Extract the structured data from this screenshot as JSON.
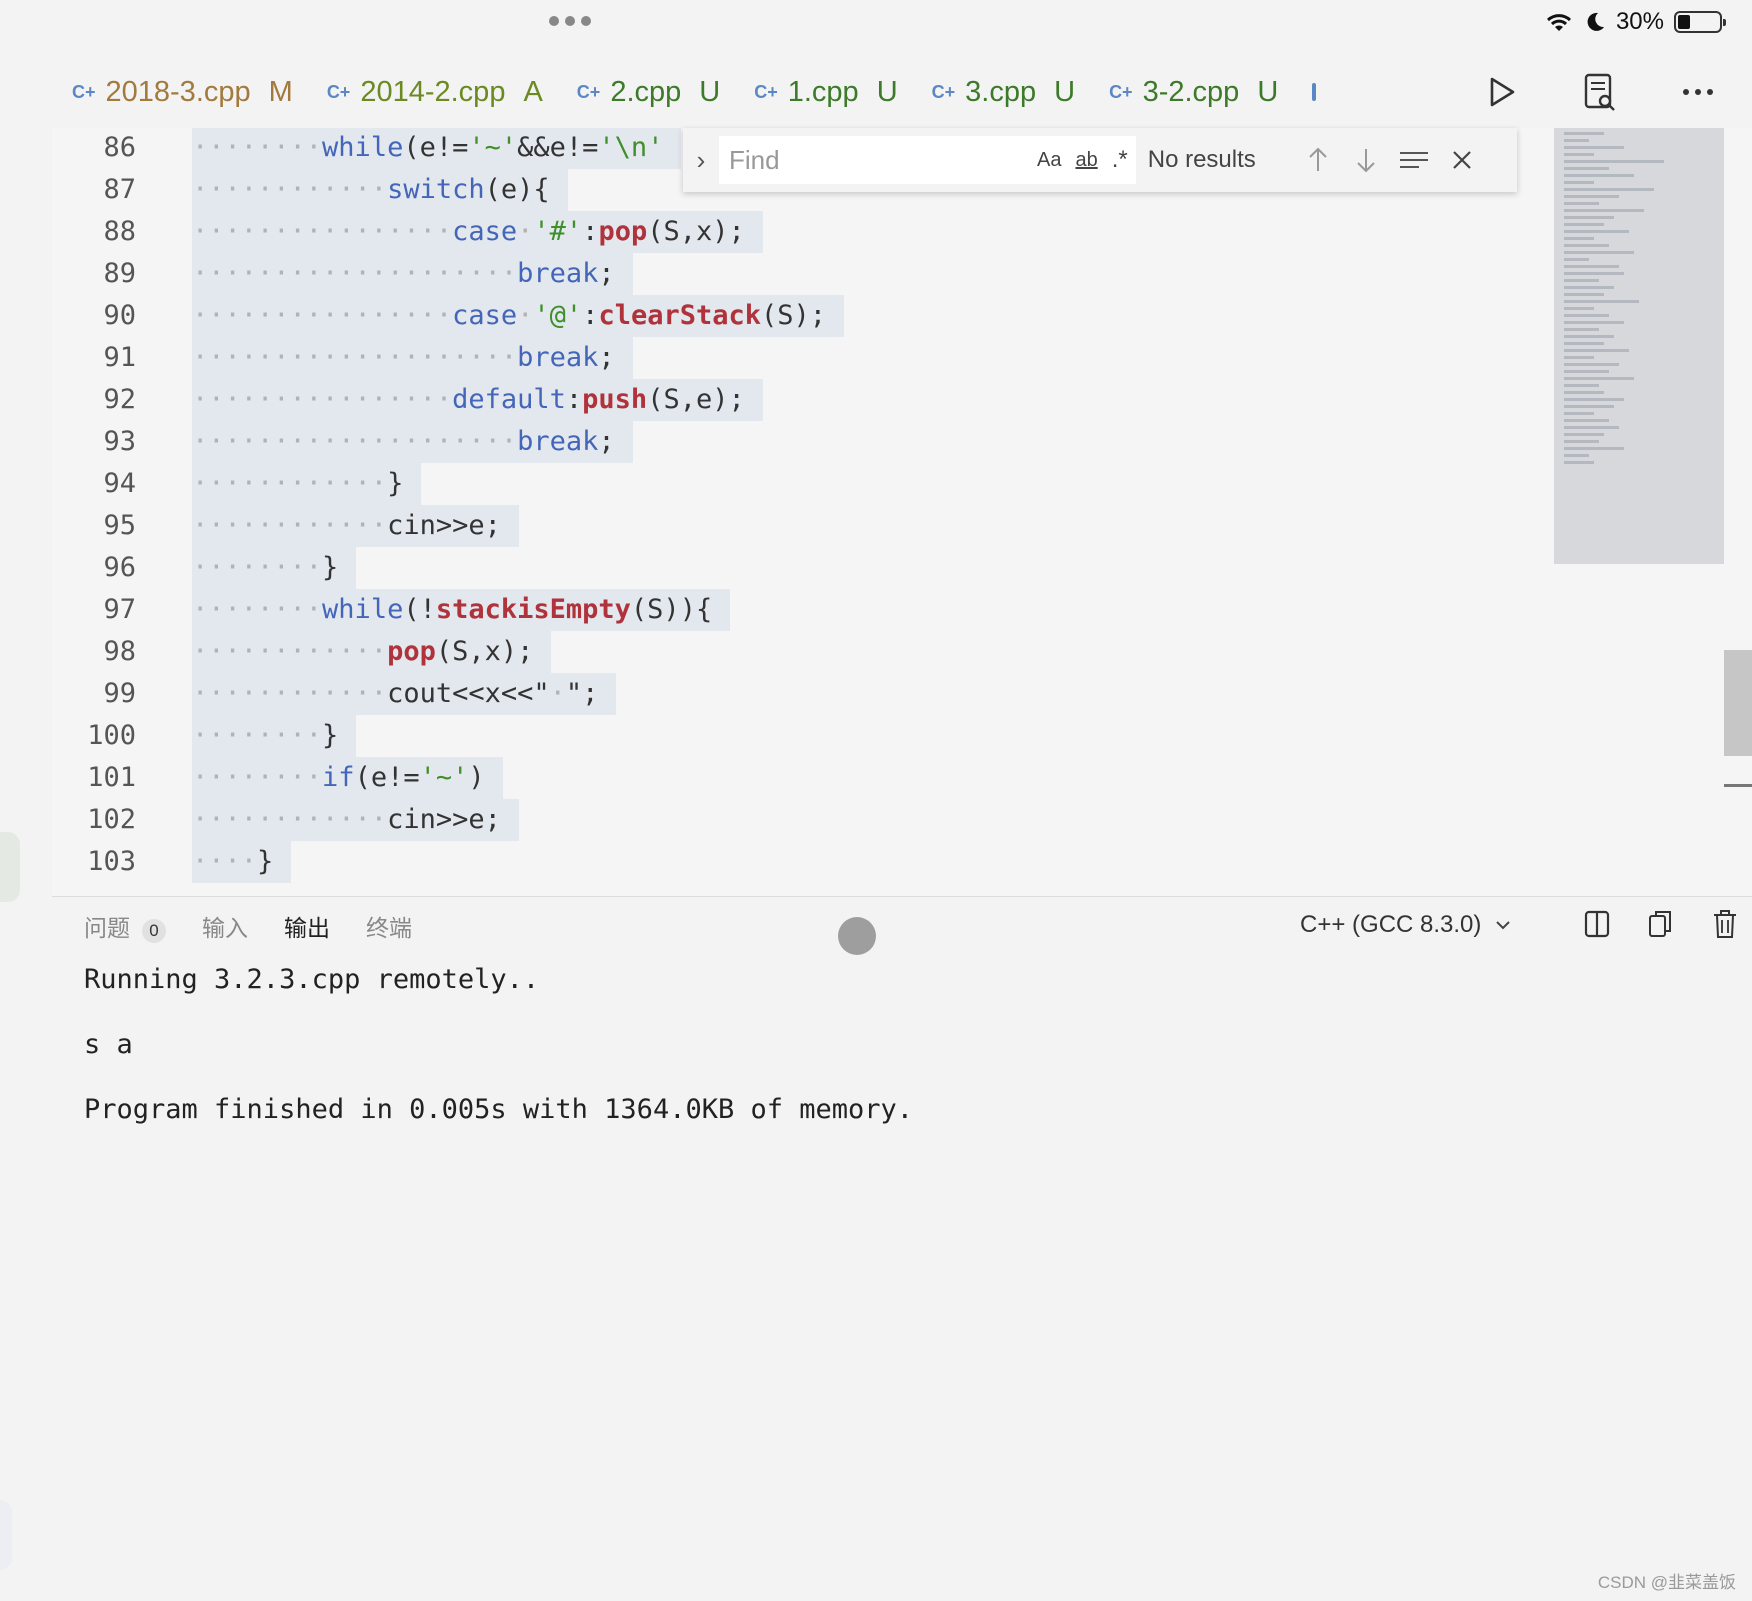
{
  "status": {
    "battery_percent": "30%",
    "battery_level": 0.3
  },
  "tabs": [
    {
      "name": "2018-3.cpp",
      "badge": "M",
      "color": "#a27a3d"
    },
    {
      "name": "2014-2.cpp",
      "badge": "A",
      "color": "#6b8a22"
    },
    {
      "name": "2.cpp",
      "badge": "U",
      "color": "#3d7a2a"
    },
    {
      "name": "1.cpp",
      "badge": "U",
      "color": "#3d7a2a"
    },
    {
      "name": "3.cpp",
      "badge": "U",
      "color": "#3d7a2a"
    },
    {
      "name": "3-2.cpp",
      "badge": "U",
      "color": "#3d7a2a"
    }
  ],
  "tab_icons": {
    "file": "cpp-file-icon",
    "run": "run-icon",
    "search": "search-document-icon",
    "more": "more-icon"
  },
  "find": {
    "placeholder": "Find",
    "match_case": "Aa",
    "whole_word": "ab",
    "regex": ".*",
    "status": "No results"
  },
  "code": {
    "lines": [
      {
        "n": "86",
        "t": [
          [
            "ws",
            "········"
          ],
          [
            "kw",
            "while"
          ],
          [
            "pl",
            "(e!="
          ],
          [
            "st",
            "'~'"
          ],
          [
            "pl",
            "&&e!="
          ],
          [
            "st",
            "'\\n'"
          ]
        ]
      },
      {
        "n": "87",
        "t": [
          [
            "ws",
            "············"
          ],
          [
            "kw",
            "switch"
          ],
          [
            "pl",
            "(e){"
          ]
        ]
      },
      {
        "n": "88",
        "t": [
          [
            "ws",
            "················"
          ],
          [
            "kw",
            "case"
          ],
          [
            "ws",
            "·"
          ],
          [
            "st",
            "'#'"
          ],
          [
            "pl",
            ":"
          ],
          [
            "fn",
            "pop"
          ],
          [
            "pl",
            "(S,x);"
          ]
        ]
      },
      {
        "n": "89",
        "t": [
          [
            "ws",
            "····················"
          ],
          [
            "kw",
            "break"
          ],
          [
            "pl",
            ";"
          ]
        ]
      },
      {
        "n": "90",
        "t": [
          [
            "ws",
            "················"
          ],
          [
            "kw",
            "case"
          ],
          [
            "ws",
            "·"
          ],
          [
            "st",
            "'@'"
          ],
          [
            "pl",
            ":"
          ],
          [
            "fn",
            "clearStack"
          ],
          [
            "pl",
            "(S);"
          ]
        ]
      },
      {
        "n": "91",
        "t": [
          [
            "ws",
            "····················"
          ],
          [
            "kw",
            "break"
          ],
          [
            "pl",
            ";"
          ]
        ]
      },
      {
        "n": "92",
        "t": [
          [
            "ws",
            "················"
          ],
          [
            "kw",
            "default"
          ],
          [
            "pl",
            ":"
          ],
          [
            "fn",
            "push"
          ],
          [
            "pl",
            "(S,e);"
          ]
        ]
      },
      {
        "n": "93",
        "t": [
          [
            "ws",
            "····················"
          ],
          [
            "kw",
            "break"
          ],
          [
            "pl",
            ";"
          ]
        ]
      },
      {
        "n": "94",
        "t": [
          [
            "ws",
            "············"
          ],
          [
            "pl",
            "}"
          ]
        ]
      },
      {
        "n": "95",
        "t": [
          [
            "ws",
            "············"
          ],
          [
            "pl",
            "cin>>e;"
          ]
        ]
      },
      {
        "n": "96",
        "t": [
          [
            "ws",
            "········"
          ],
          [
            "pl",
            "}"
          ]
        ]
      },
      {
        "n": "97",
        "t": [
          [
            "ws",
            "········"
          ],
          [
            "kw",
            "while"
          ],
          [
            "pl",
            "(!"
          ],
          [
            "fn",
            "stackisEmpty"
          ],
          [
            "pl",
            "(S)){"
          ]
        ]
      },
      {
        "n": "98",
        "t": [
          [
            "ws",
            "············"
          ],
          [
            "fn",
            "pop"
          ],
          [
            "pl",
            "(S,x);"
          ]
        ]
      },
      {
        "n": "99",
        "t": [
          [
            "ws",
            "············"
          ],
          [
            "pl",
            "cout<<x<<\""
          ],
          [
            "ws",
            "·"
          ],
          [
            "pl",
            "\";"
          ]
        ]
      },
      {
        "n": "100",
        "t": [
          [
            "ws",
            "········"
          ],
          [
            "pl",
            "}"
          ]
        ]
      },
      {
        "n": "101",
        "t": [
          [
            "ws",
            "········"
          ],
          [
            "kw",
            "if"
          ],
          [
            "pl",
            "(e!="
          ],
          [
            "st",
            "'~'"
          ],
          [
            "pl",
            ")"
          ]
        ]
      },
      {
        "n": "102",
        "t": [
          [
            "ws",
            "············"
          ],
          [
            "pl",
            "cin>>e;"
          ]
        ]
      },
      {
        "n": "103",
        "t": [
          [
            "ws",
            "····"
          ],
          [
            "pl",
            "}"
          ]
        ]
      }
    ]
  },
  "panel": {
    "tabs": [
      {
        "label": "问题",
        "badge": "0",
        "active": false
      },
      {
        "label": "输入",
        "active": false
      },
      {
        "label": "输出",
        "active": true
      },
      {
        "label": "终端",
        "active": false
      }
    ],
    "language": "C++ (GCC 8.3.0)",
    "output": [
      "Running 3.2.3.cpp remotely..",
      "s a",
      "Program finished in 0.005s with 1364.0KB of memory."
    ]
  },
  "watermark": "CSDN @韭菜盖饭"
}
